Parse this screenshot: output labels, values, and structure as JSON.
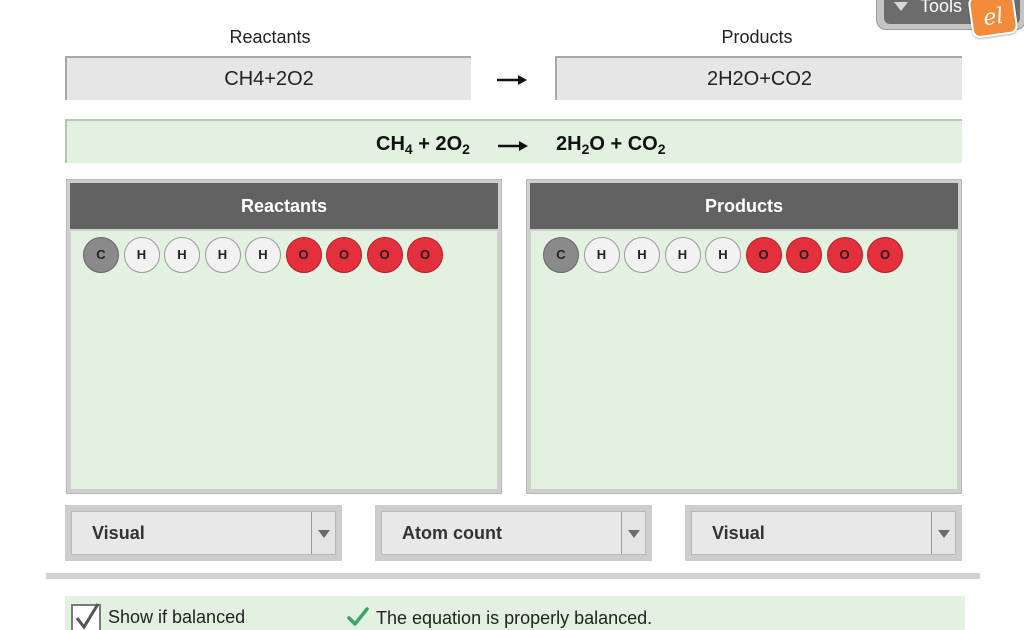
{
  "tools": {
    "label": "Tools",
    "badge": "el"
  },
  "equation": {
    "reactants_label": "Reactants",
    "products_label": "Products",
    "reactants_input": "CH4+2O2",
    "products_input": "2H2O+CO2",
    "arrow_icon": "right-arrow-icon"
  },
  "formula": {
    "reactants": [
      {
        "text": "CH",
        "sub": "4"
      },
      {
        "text": " + 2O",
        "sub": "2"
      }
    ],
    "products": [
      {
        "text": "2H",
        "sub": "2"
      },
      {
        "text": "O + CO",
        "sub": "2"
      }
    ]
  },
  "panels": [
    {
      "title": "Reactants",
      "atoms": [
        "C",
        "H",
        "H",
        "H",
        "H",
        "O",
        "O",
        "O",
        "O"
      ]
    },
    {
      "title": "Products",
      "atoms": [
        "C",
        "H",
        "H",
        "H",
        "H",
        "O",
        "O",
        "O",
        "O"
      ]
    }
  ],
  "dropdowns": [
    {
      "value": "Visual"
    },
    {
      "value": "Atom count"
    },
    {
      "value": "Visual"
    }
  ],
  "balance": {
    "checkbox_label": "Show if balanced",
    "checked": true,
    "status_text": "The equation is properly balanced."
  },
  "colors": {
    "panel_green": "#e2f1e0",
    "panel_header": "#626262",
    "oxygen": "#e3303c",
    "carbon": "#8a8a8a",
    "hydrogen": "#f2f2f2",
    "check_green": "#3aa56a"
  }
}
